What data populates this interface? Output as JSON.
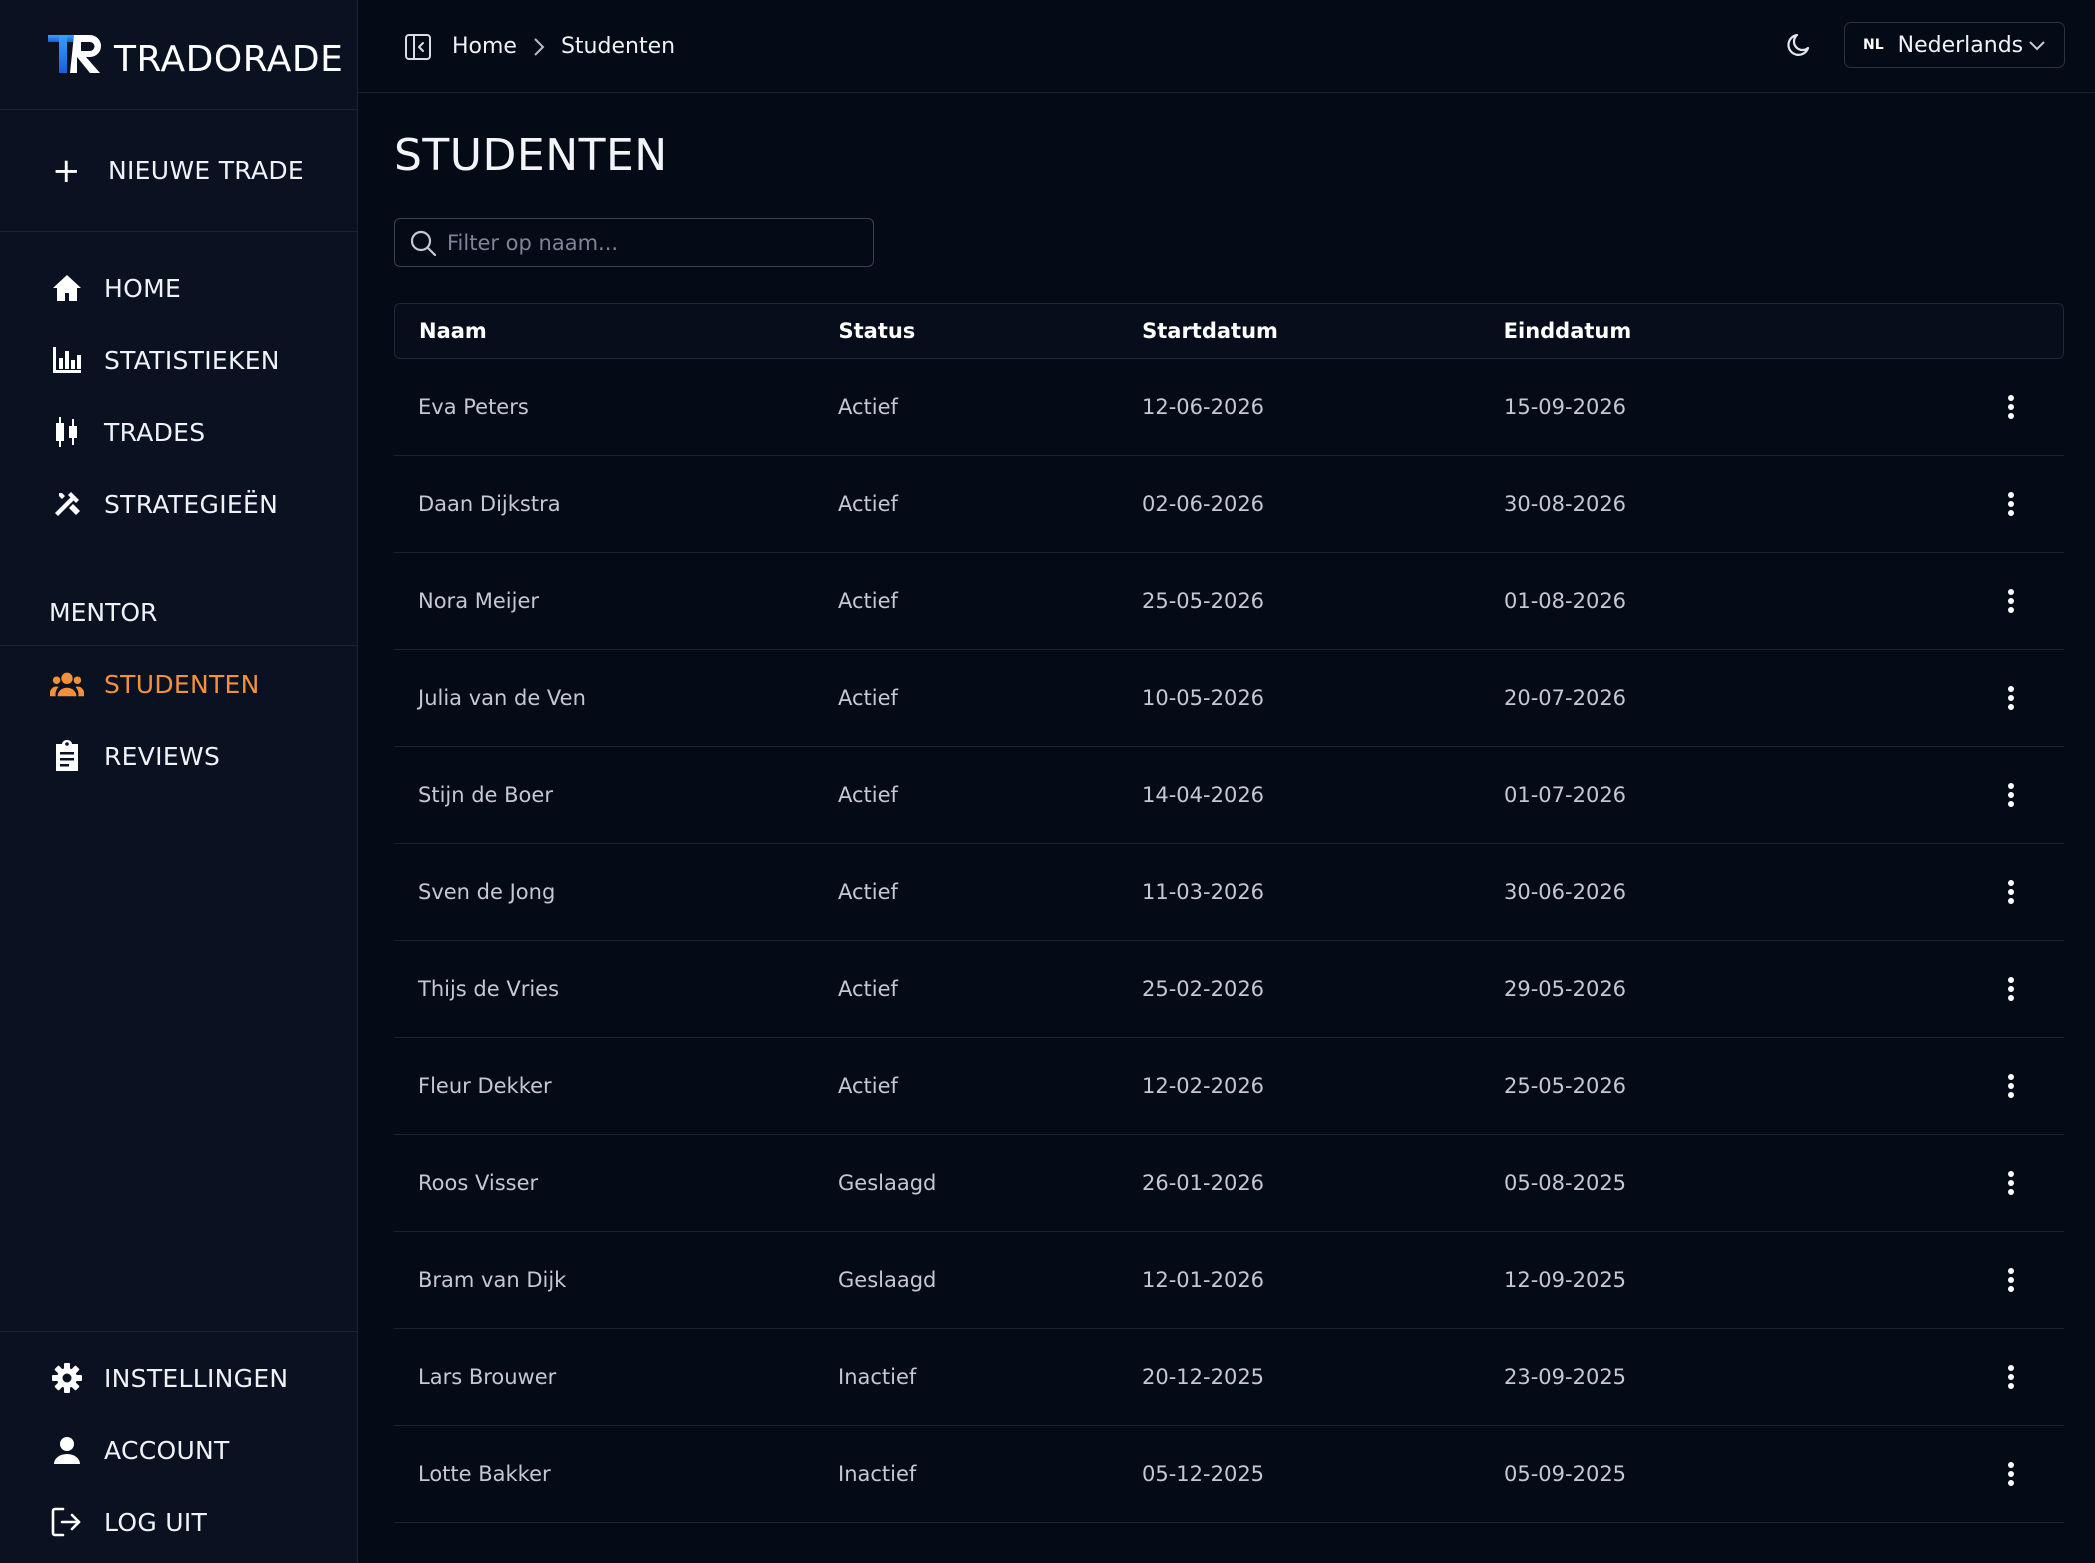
{
  "brand": {
    "logo_letters": "TR",
    "name": "TRADORADE"
  },
  "sidebar": {
    "new_trade": "NIEUWE TRADE",
    "items": [
      {
        "label": "HOME",
        "icon": "home-icon"
      },
      {
        "label": "STATISTIEKEN",
        "icon": "bar-chart-icon"
      },
      {
        "label": "TRADES",
        "icon": "candlestick-icon"
      },
      {
        "label": "STRATEGIEËN",
        "icon": "tools-icon"
      }
    ],
    "mentor_title": "MENTOR",
    "mentor_items": [
      {
        "label": "STUDENTEN",
        "icon": "users-icon",
        "active": true
      },
      {
        "label": "REVIEWS",
        "icon": "clipboard-icon"
      }
    ],
    "bottom_items": [
      {
        "label": "INSTELLINGEN",
        "icon": "gear-icon"
      },
      {
        "label": "ACCOUNT",
        "icon": "user-icon"
      },
      {
        "label": "LOG UIT",
        "icon": "logout-icon"
      }
    ]
  },
  "header": {
    "breadcrumb": [
      "Home",
      "Studenten"
    ],
    "language": {
      "code": "NL",
      "name": "Nederlands"
    }
  },
  "main": {
    "title": "STUDENTEN",
    "search_placeholder": "Filter op naam...",
    "columns": {
      "name": "Naam",
      "status": "Status",
      "start": "Startdatum",
      "end": "Einddatum"
    },
    "rows": [
      {
        "name": "Eva Peters",
        "status": "Actief",
        "start": "12-06-2026",
        "end": "15-09-2026"
      },
      {
        "name": "Daan Dijkstra",
        "status": "Actief",
        "start": "02-06-2026",
        "end": "30-08-2026"
      },
      {
        "name": "Nora Meijer",
        "status": "Actief",
        "start": "25-05-2026",
        "end": "01-08-2026"
      },
      {
        "name": "Julia van de Ven",
        "status": "Actief",
        "start": "10-05-2026",
        "end": "20-07-2026"
      },
      {
        "name": "Stijn de Boer",
        "status": "Actief",
        "start": "14-04-2026",
        "end": "01-07-2026"
      },
      {
        "name": "Sven de Jong",
        "status": "Actief",
        "start": "11-03-2026",
        "end": "30-06-2026"
      },
      {
        "name": "Thijs de Vries",
        "status": "Actief",
        "start": "25-02-2026",
        "end": "29-05-2026"
      },
      {
        "name": "Fleur Dekker",
        "status": "Actief",
        "start": "12-02-2026",
        "end": "25-05-2026"
      },
      {
        "name": "Roos Visser",
        "status": "Geslaagd",
        "start": "26-01-2026",
        "end": "05-08-2025"
      },
      {
        "name": "Bram van Dijk",
        "status": "Geslaagd",
        "start": "12-01-2026",
        "end": "12-09-2025"
      },
      {
        "name": "Lars Brouwer",
        "status": "Inactief",
        "start": "20-12-2025",
        "end": "23-09-2025"
      },
      {
        "name": "Lotte Bakker",
        "status": "Inactief",
        "start": "05-12-2025",
        "end": "05-09-2025"
      }
    ]
  },
  "colors": {
    "accent": "#f2913a",
    "logo_blue": "#1f7ef0",
    "background": "#050a17",
    "sidebar": "#0a1222"
  }
}
